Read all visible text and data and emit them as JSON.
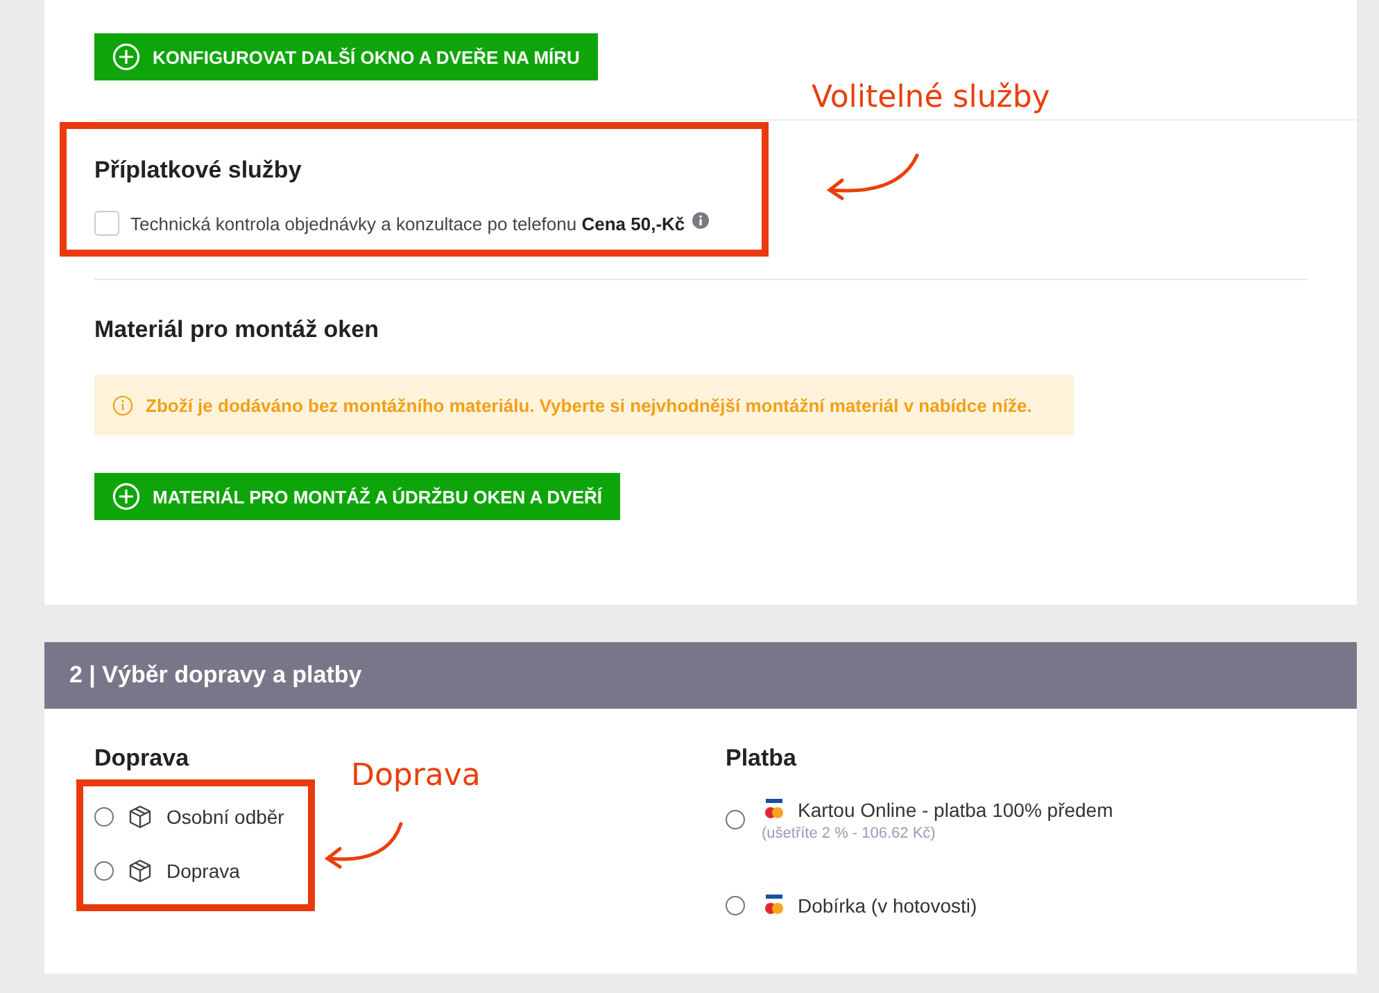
{
  "configure_button": {
    "label": "KONFIGUROVAT DALŠÍ OKNO A DVEŘE NA MÍRU"
  },
  "extra_services": {
    "title": "Příplatkové služby",
    "options": [
      {
        "label": "Technická kontrola objednávky a konzultace po telefonu **Cena 50,-Kč**",
        "checked": false
      }
    ]
  },
  "mounting": {
    "title": "Materiál pro montáž oken",
    "notice": "Zboží je dodáváno bez montážního materiálu. Vyberte si nejvhodnější montážní materiál v nabídce níže.",
    "button": "MATERIÁL PRO MONTÁŽ A ÚDRŽBU OKEN A DVEŘÍ"
  },
  "step2": {
    "title": "2 | Výběr dopravy a platby",
    "shipping": {
      "title": "Doprava",
      "options": [
        {
          "label": "Osobní odběr",
          "selected": false
        },
        {
          "label": "Doprava",
          "selected": false
        }
      ]
    },
    "payment": {
      "title": "Platba",
      "options": [
        {
          "label": "Kartou Online - platba 100% předem",
          "note": "(ušetříte 2 % - 106.62 Kč)",
          "selected": false
        },
        {
          "label": "Dobírka (v hotovosti)",
          "selected": false
        }
      ]
    }
  },
  "annotations": [
    {
      "label": "Volitelné služby"
    },
    {
      "label": "Doprava"
    }
  ]
}
